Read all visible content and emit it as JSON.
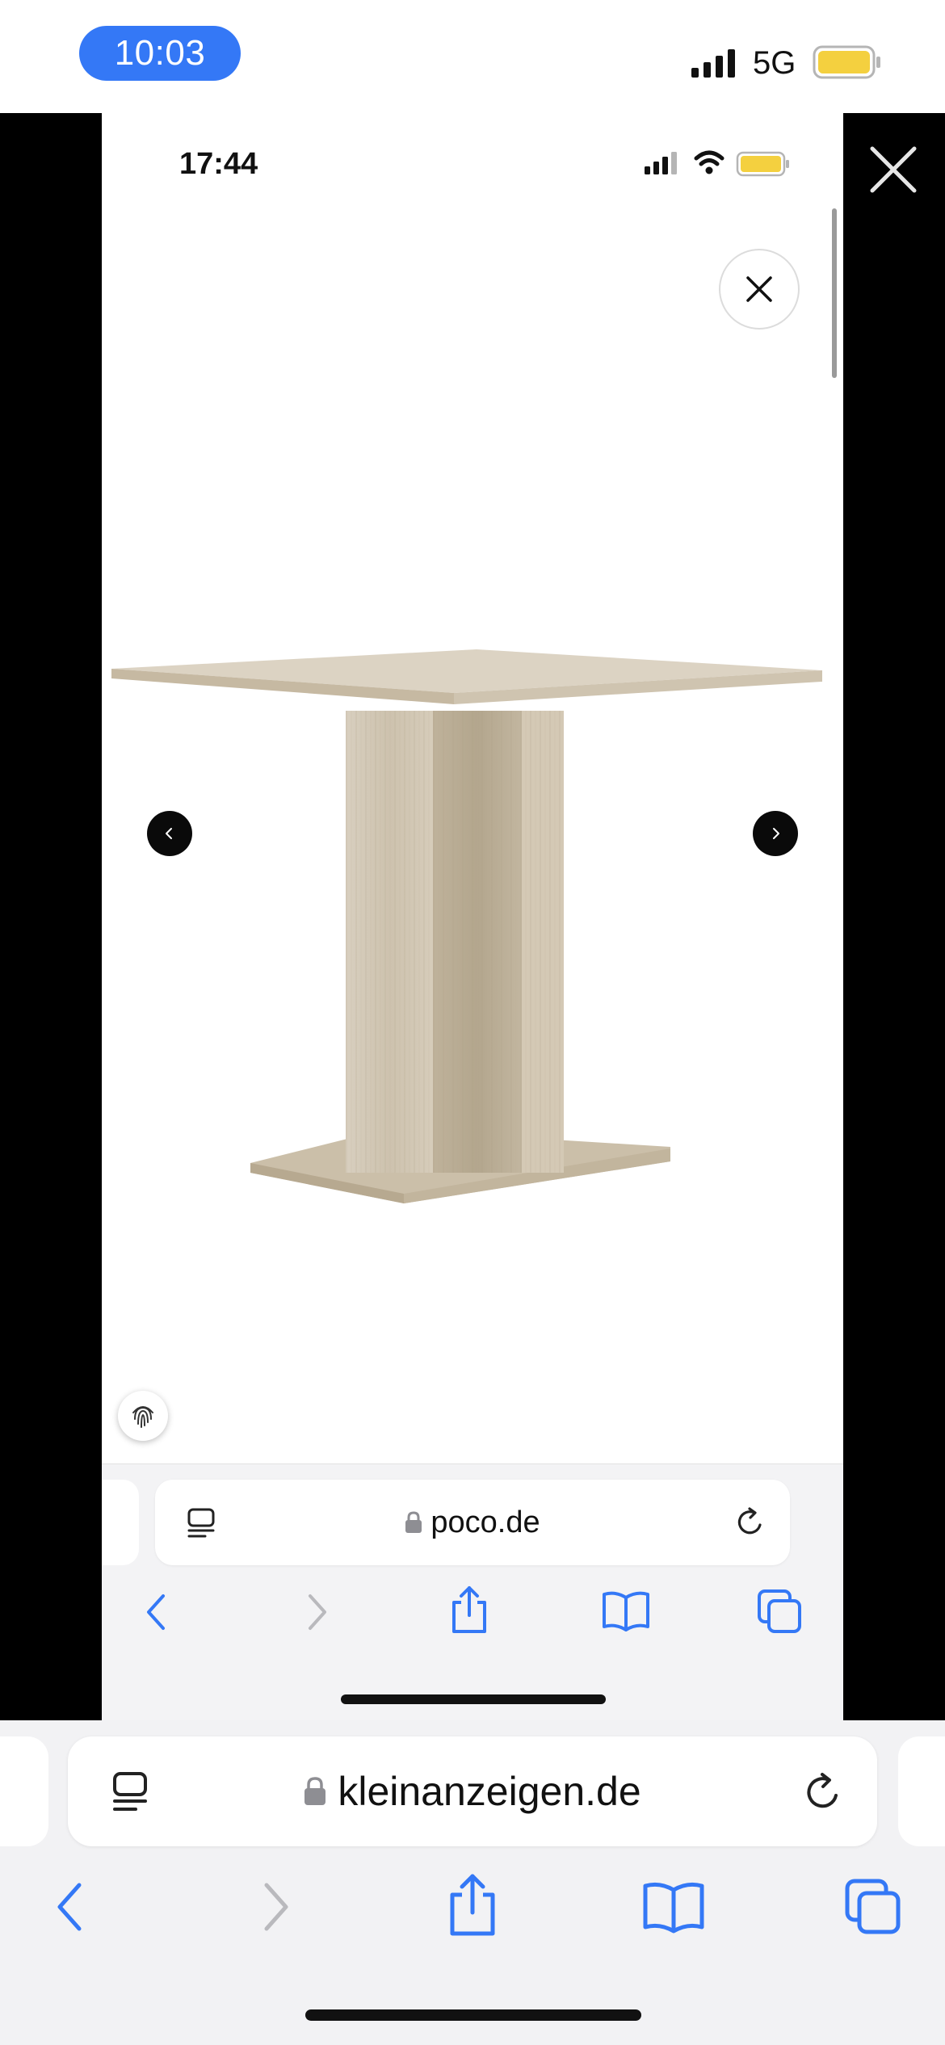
{
  "outer_status": {
    "time": "10:03",
    "network": "5G",
    "battery_color": "#f4d03f"
  },
  "inner_status": {
    "time": "17:44",
    "battery_color": "#f4d03f"
  },
  "product": {
    "image_description_icon": "pedestal-dining-table"
  },
  "inner_browser": {
    "url": "poco.de",
    "toolbar_icons": [
      "reader-icon",
      "lock-icon",
      "reload-icon",
      "back-icon",
      "forward-icon",
      "share-icon",
      "bookmarks-icon",
      "tabs-icon"
    ]
  },
  "outer_browser": {
    "url": "kleinanzeigen.de"
  },
  "colors": {
    "accent": "#3478f6",
    "toolbar_bg": "#f2f2f4",
    "viewer_bg": "#000000"
  }
}
